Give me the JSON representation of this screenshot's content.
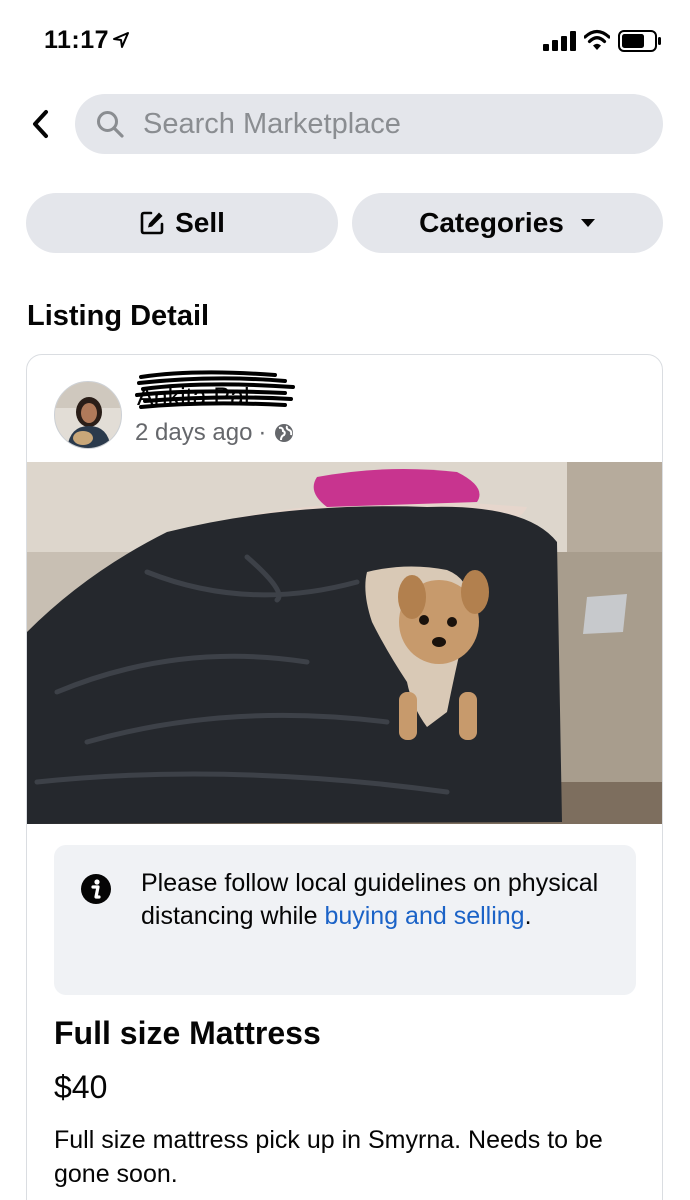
{
  "status_bar": {
    "time": "11:17"
  },
  "search": {
    "placeholder": "Search Marketplace"
  },
  "actions": {
    "sell_label": "Sell",
    "categories_label": "Categories"
  },
  "page": {
    "section_title": "Listing Detail"
  },
  "post": {
    "seller_name": "Ankita Pal",
    "time_ago": "2 days ago",
    "separator": "·"
  },
  "notice": {
    "text_before": "Please follow local guidelines on physical distancing while ",
    "link_text": "buying and selling",
    "text_after": "."
  },
  "listing": {
    "title": "Full size Mattress",
    "price": "$40",
    "description": "Full size mattress pick up in Smyrna. Needs to be gone soon."
  },
  "colors": {
    "pill_bg": "#e4e6eb",
    "link": "#1b63c7",
    "secondary_text": "#65676b",
    "notice_bg": "#f0f2f5"
  },
  "icons": [
    "location-arrow-icon",
    "signal-icon",
    "wifi-icon",
    "battery-icon",
    "back-chevron-icon",
    "search-icon",
    "edit-icon",
    "caret-down-icon",
    "globe-icon",
    "info-icon"
  ]
}
